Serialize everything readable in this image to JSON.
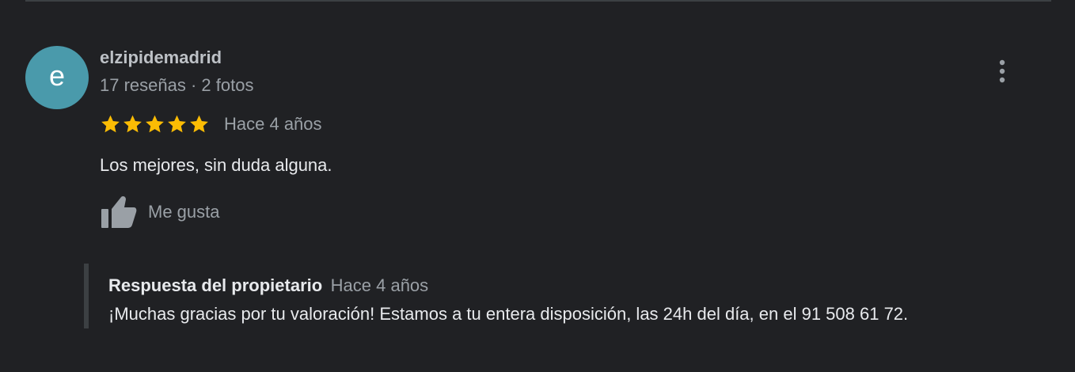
{
  "review": {
    "avatar_letter": "e",
    "author_name": "elzipidemadrid",
    "author_meta": "17 reseñas · 2 fotos",
    "rating": 5,
    "rating_max": 5,
    "date": "Hace 4 años",
    "text": "Los mejores, sin duda alguna.",
    "like_label": "Me gusta"
  },
  "owner_reply": {
    "title": "Respuesta del propietario",
    "date": "Hace 4 años",
    "text": "¡Muchas gracias por tu valoración! Estamos a tu entera disposición, las 24h del día, en el 91 508 61 72."
  },
  "icons": {
    "more": "more-vert-icon",
    "star": "star-icon",
    "like": "thumbs-up-icon"
  },
  "colors": {
    "background": "#202124",
    "avatar": "#4a9aab",
    "star": "#fbbc04",
    "text_primary": "#e8eaed",
    "text_secondary": "#9aa0a6",
    "reply_bar": "#3c4043"
  }
}
